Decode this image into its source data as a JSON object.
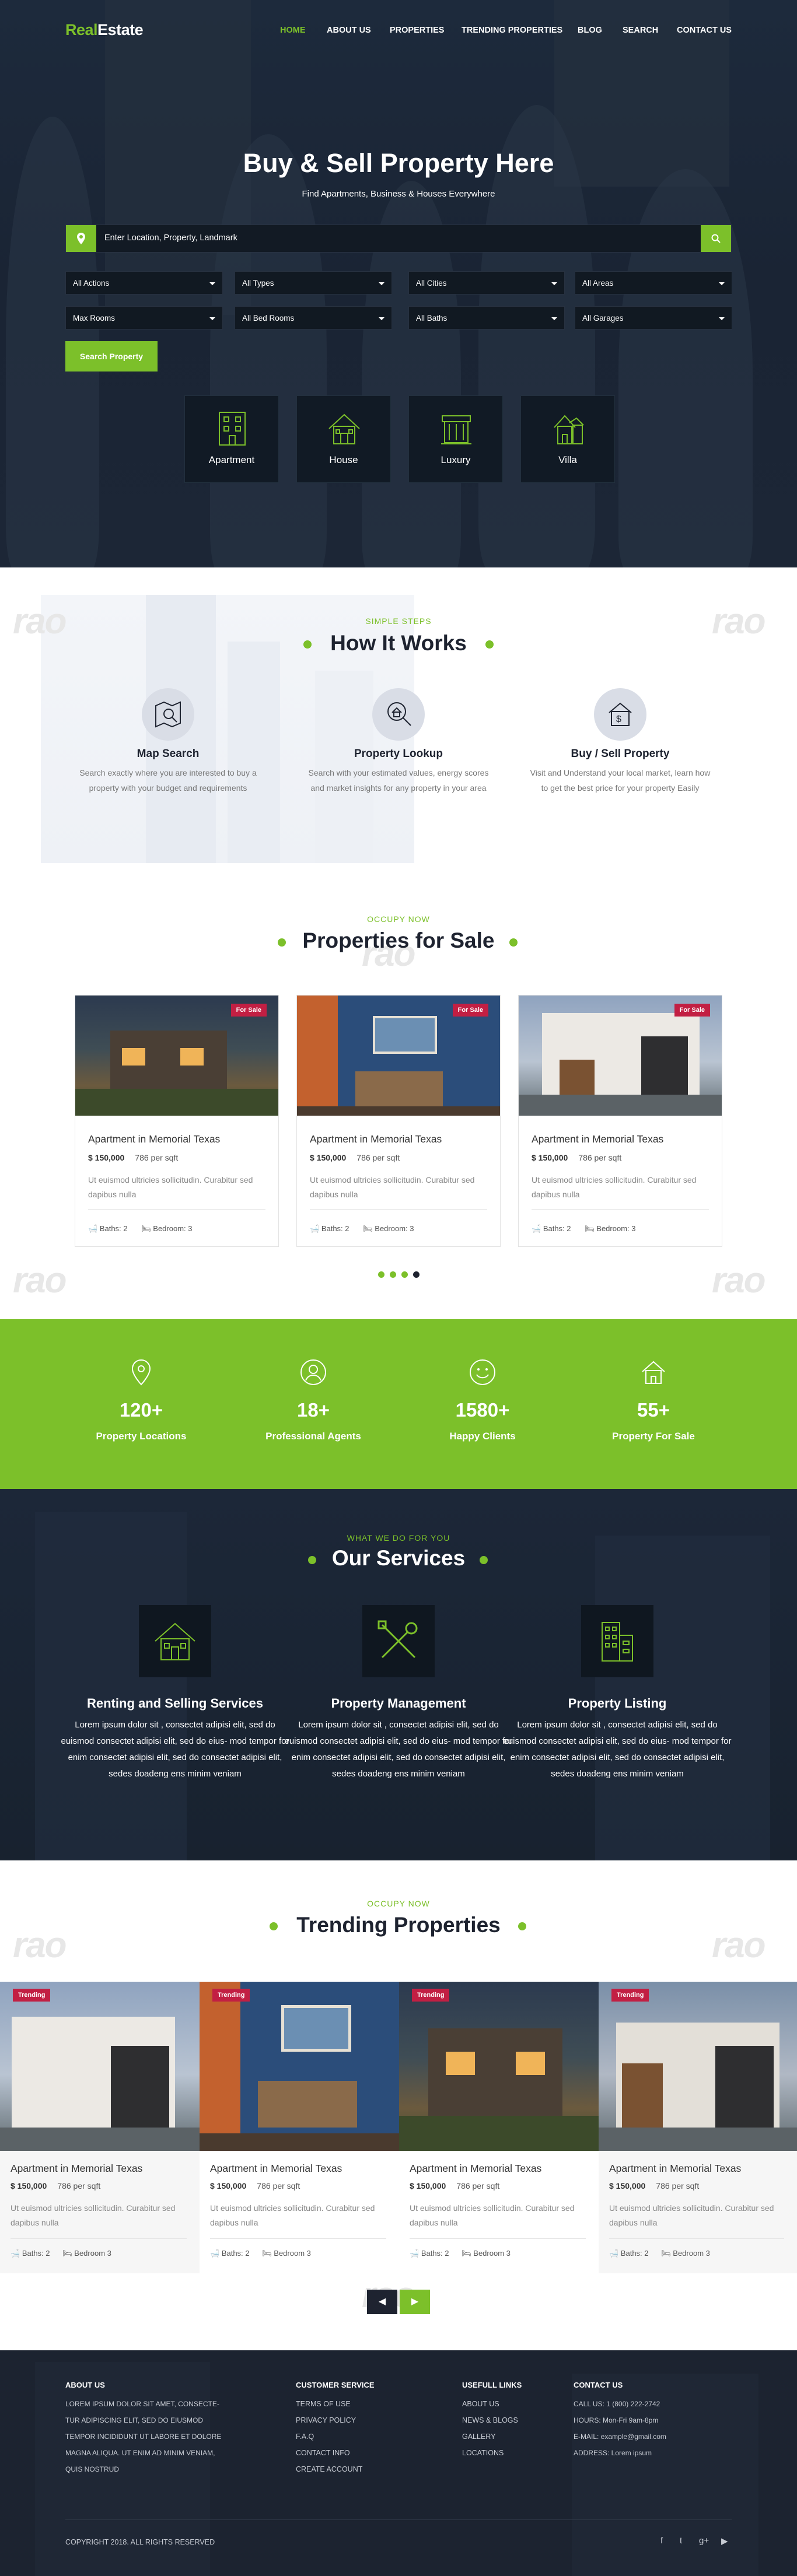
{
  "brand": {
    "part1": "Real",
    "part2": "Estate"
  },
  "nav": [
    "HOME",
    "ABOUT US",
    "PROPERTIES",
    "TRENDING PROPERTIES",
    "BLOG",
    "SEARCH",
    "CONTACT US"
  ],
  "hero": {
    "title": "Buy & Sell Property Here",
    "subtitle": "Find Apartments, Business & Houses Everywhere",
    "search_placeholder": "Enter Location, Property, Landmark",
    "filters_row1": [
      "All Actions",
      "All Types",
      "All Cities",
      "All Areas"
    ],
    "filters_row2": [
      "Max Rooms",
      "All Bed Rooms",
      "All Baths",
      "All Garages"
    ],
    "search_button": "Search Property",
    "categories": [
      "Apartment",
      "House",
      "Luxury",
      "Villa"
    ]
  },
  "how": {
    "kicker": "SIMPLE STEPS",
    "title": "How It Works",
    "steps": [
      {
        "title": "Map Search",
        "desc": "Search exactly where you are interested to buy a property with your budget and requirements",
        "icon": "map-search-icon"
      },
      {
        "title": "Property Lookup",
        "desc": "Search with your estimated values, energy scores and market insights for any property in your area",
        "icon": "magnifier-house-icon"
      },
      {
        "title": "Buy / Sell Property",
        "desc": "Visit and Understand your local market, learn how to get the best price for your property Easily",
        "icon": "dollar-house-icon"
      }
    ]
  },
  "sale": {
    "kicker": "OCCUPY NOW",
    "title": "Properties for Sale",
    "cards": [
      {
        "badge": "For Sale",
        "title": "Apartment in Memorial Texas",
        "price": "$ 150,000",
        "area": "786 per sqft",
        "desc": "Ut euismod ultricies sollicitudin. Curabitur sed dapibus nulla",
        "baths": "Baths: 2",
        "beds": "Bedroom: 3"
      },
      {
        "badge": "For Sale",
        "title": "Apartment in Memorial Texas",
        "price": "$ 150,000",
        "area": "786 per sqft",
        "desc": "Ut euismod ultricies sollicitudin. Curabitur sed dapibus nulla",
        "baths": "Baths: 2",
        "beds": "Bedroom: 3"
      },
      {
        "badge": "For Sale",
        "title": "Apartment in Memorial Texas",
        "price": "$ 150,000",
        "area": "786 per sqft",
        "desc": "Ut euismod ultricies sollicitudin. Curabitur sed dapibus nulla",
        "baths": "Baths: 2",
        "beds": "Bedroom: 3"
      }
    ]
  },
  "stats": [
    {
      "value": "120+",
      "label": "Property Locations",
      "icon": "location-pin-icon"
    },
    {
      "value": "18+",
      "label": "Professional Agents",
      "icon": "agent-icon"
    },
    {
      "value": "1580+",
      "label": "Happy Clients",
      "icon": "smile-icon"
    },
    {
      "value": "55+",
      "label": "Property For Sale",
      "icon": "home-icon"
    }
  ],
  "services": {
    "kicker": "WHAT WE DO FOR YOU",
    "title": "Our Services",
    "items": [
      {
        "title": "Renting and Selling Services",
        "desc": "Lorem ipsum dolor sit , consectet adipisi elit, sed do euismod consectet adipisi elit, sed do eius- mod tempor for enim consectet adipisi elit, sed do consectet adipisi elit, sedes doadeng ens minim veniam"
      },
      {
        "title": "Property Management",
        "desc": "Lorem ipsum dolor sit , consectet adipisi elit, sed do euismod consectet adipisi elit, sed do eius- mod tempor for enim consectet adipisi elit, sed do consectet adipisi elit, sedes doadeng ens minim veniam"
      },
      {
        "title": "Property Listing",
        "desc": "Lorem ipsum dolor sit , consectet adipisi elit, sed do euismod consectet adipisi elit, sed do eius- mod tempor for enim consectet adipisi elit, sed do consectet adipisi elit, sedes doadeng ens minim veniam"
      }
    ]
  },
  "trending": {
    "kicker": "OCCUPY NOW",
    "title": "Trending Properties",
    "cards": [
      {
        "badge": "Trending",
        "title": "Apartment in Memorial Texas",
        "price": "$ 150,000",
        "area": "786 per sqft",
        "desc": "Ut euismod ultricies sollicitudin. Curabitur sed dapibus nulla",
        "baths": "Baths: 2",
        "beds": "Bedroom 3"
      },
      {
        "badge": "Trending",
        "title": "Apartment in Memorial Texas",
        "price": "$ 150,000",
        "area": "786 per sqft",
        "desc": "Ut euismod ultricies sollicitudin. Curabitur sed dapibus nulla",
        "baths": "Baths: 2",
        "beds": "Bedroom 3"
      },
      {
        "badge": "Trending",
        "title": "Apartment in Memorial Texas",
        "price": "$ 150,000",
        "area": "786 per sqft",
        "desc": "Ut euismod ultricies sollicitudin. Curabitur sed dapibus nulla",
        "baths": "Baths: 2",
        "beds": "Bedroom 3"
      },
      {
        "badge": "Trending",
        "title": "Apartment in Memorial Texas",
        "price": "$ 150,000",
        "area": "786 per sqft",
        "desc": "Ut euismod ultricies sollicitudin. Curabitur sed dapibus nulla",
        "baths": "Baths: 2",
        "beds": "Bedroom 3"
      }
    ]
  },
  "watermark": "rao",
  "footer": {
    "about": {
      "title": "ABOUT US",
      "lines": [
        "LOREM IPSUM DOLOR SIT AMET, CONSECTE-",
        "TUR ADIPISCING ELIT, SED DO EIUSMOD",
        "TEMPOR INCIDIDUNT UT LABORE ET DOLORE",
        "MAGNA ALIQUA. UT ENIM AD MINIM VENIAM,",
        "QUIS NOSTRUD"
      ]
    },
    "customer": {
      "title": "CUSTOMER SERVICE",
      "links": [
        "TERMS OF USE",
        "PRIVACY POLICY",
        "F.A.Q",
        "CONTACT INFO",
        "CREATE ACCOUNT"
      ]
    },
    "useful": {
      "title": "USEFULL LINKS",
      "links": [
        "ABOUT US",
        "NEWS & BLOGS",
        "GALLERY",
        "LOCATIONS"
      ]
    },
    "contact": {
      "title": "CONTACT US",
      "lines": [
        "CALL US: 1 (800) 222-2742",
        "HOURS: Mon-Fri 9am-8pm",
        "E-MAIL: example@gmail.com",
        "ADDRESS: Lorem ipsum"
      ]
    },
    "copyright": "COPYRIGHT 2018. ALL RIGHTS RESERVED",
    "social": [
      "f",
      "t",
      "g+",
      "▶"
    ]
  },
  "colors": {
    "accent": "#7cc02a",
    "badge": "#c21f43",
    "dark": "#1c2330"
  }
}
